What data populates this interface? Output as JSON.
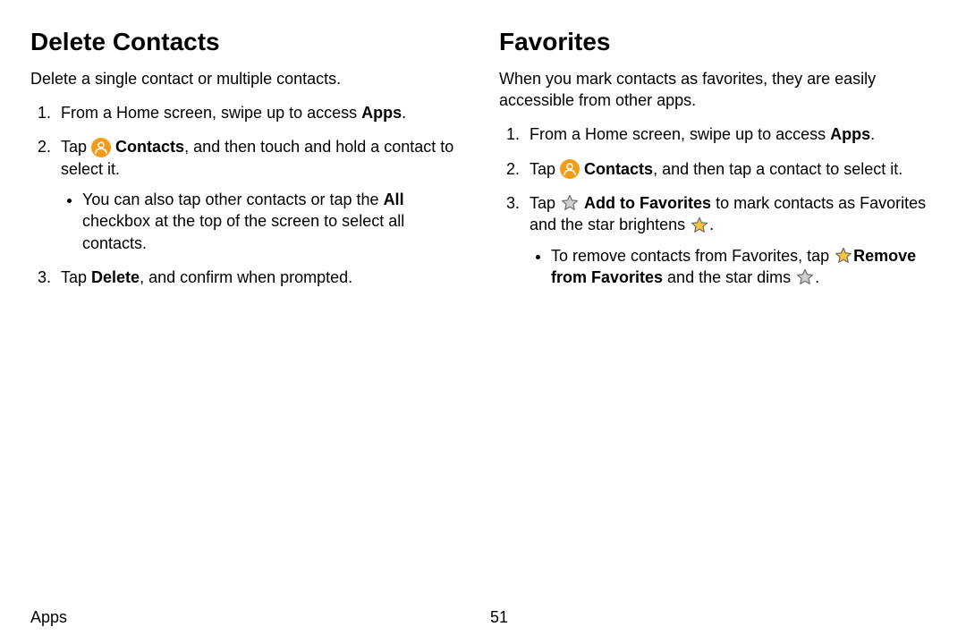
{
  "footer": {
    "section": "Apps",
    "page": "51"
  },
  "left": {
    "title": "Delete Contacts",
    "intro": "Delete a single contact or multiple contacts.",
    "step1_a": "From a Home screen, swipe up to access ",
    "step1_b": "Apps",
    "step1_c": ".",
    "step2_a": "Tap ",
    "step2_b": "Contacts",
    "step2_c": ", and then touch and hold a contact to select it.",
    "step2_sub_a": "You can also tap other contacts or tap the ",
    "step2_sub_b": "All",
    "step2_sub_c": " checkbox at the top of the screen to select all contacts.",
    "step3_a": "Tap ",
    "step3_b": "Delete",
    "step3_c": ", and confirm when prompted."
  },
  "right": {
    "title": "Favorites",
    "intro": "When you mark contacts as favorites, they are easily accessible from other apps.",
    "step1_a": "From a Home screen, swipe up to access ",
    "step1_b": "Apps",
    "step1_c": ".",
    "step2_a": "Tap ",
    "step2_b": "Contacts",
    "step2_c": ", and then tap a contact to select it.",
    "step3_a": "Tap ",
    "step3_b": "Add to Favorites",
    "step3_c": " to mark contacts as Favorites and the star brightens ",
    "step3_d": ".",
    "step3_sub_a": "To remove contacts from Favorites, tap ",
    "step3_sub_b": "Remove from Favorites",
    "step3_sub_c": " and the star dims ",
    "step3_sub_d": "."
  }
}
